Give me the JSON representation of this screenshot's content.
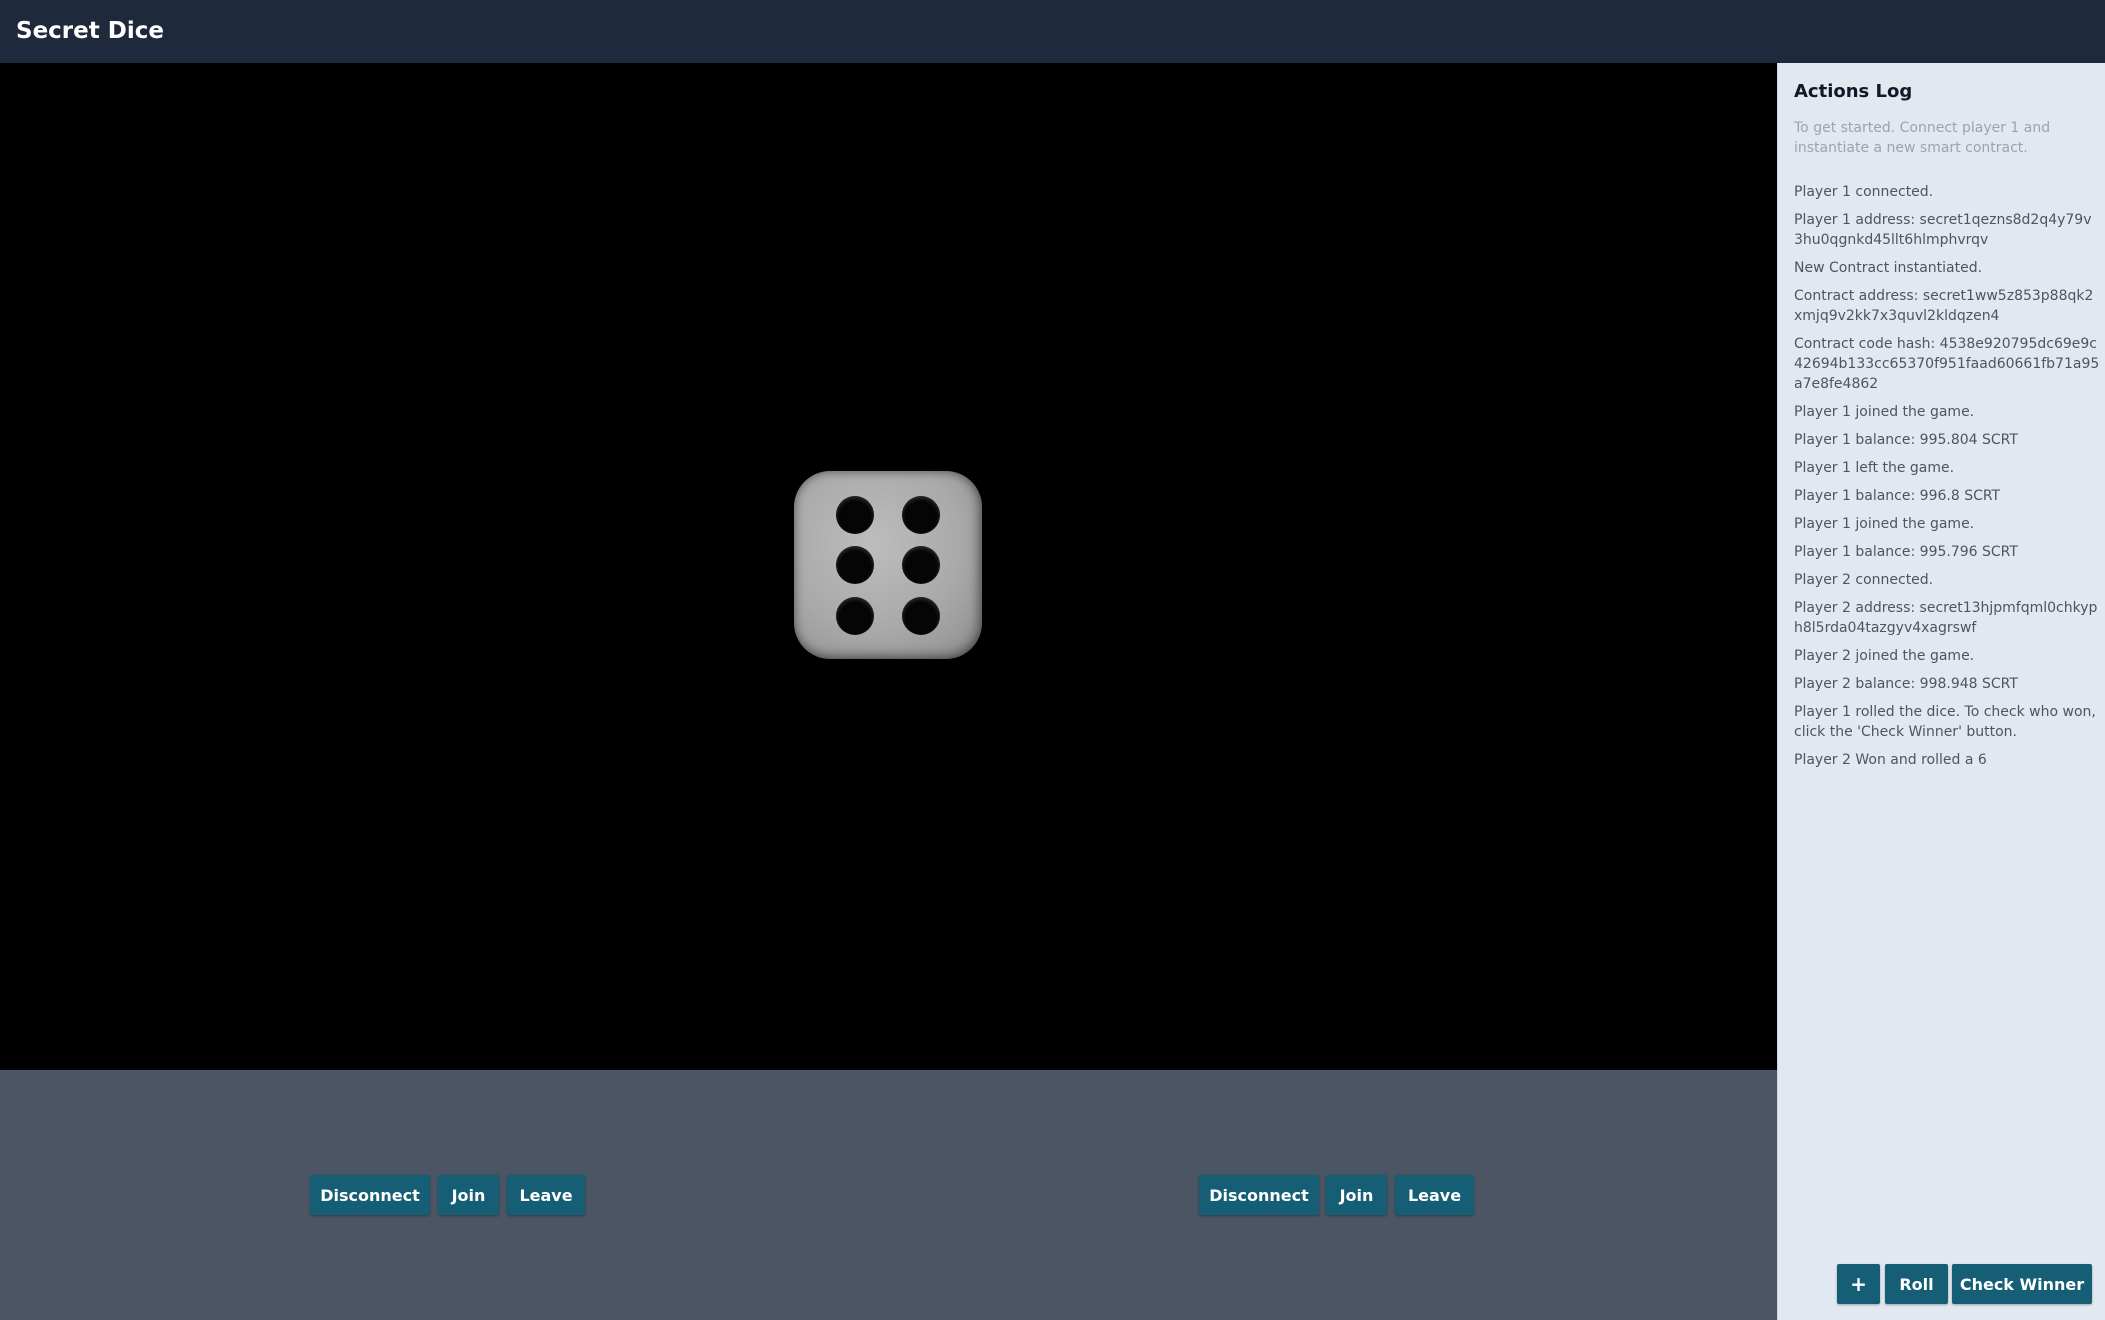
{
  "app": {
    "title": "Secret Dice"
  },
  "dice": {
    "face_value": 6,
    "pip_count": 6
  },
  "player1_controls": {
    "disconnect_label": "Disconnect",
    "join_label": "Join",
    "leave_label": "Leave"
  },
  "player2_controls": {
    "disconnect_label": "Disconnect",
    "join_label": "Join",
    "leave_label": "Leave"
  },
  "sidebar": {
    "title": "Actions Log",
    "hint": "To get started. Connect player 1 and instantiate a new smart contract.",
    "log": [
      "Player 1 connected.",
      "Player 1 address: secret1qezns8d2q4y79v3hu0qgnkd45llt6hlmphvrqv",
      "New Contract instantiated.",
      "Contract address: secret1ww5z853p88qk2xmjq9v2kk7x3quvl2kldqzen4",
      "Contract code hash: 4538e920795dc69e9c42694b133cc65370f951faad60661fb71a95a7e8fe4862",
      "Player 1 joined the game.",
      "Player 1 balance: 995.804 SCRT",
      "Player 1 left the game.",
      "Player 1 balance: 996.8 SCRT",
      "Player 1 joined the game.",
      "Player 1 balance: 995.796 SCRT",
      "Player 2 connected.",
      "Player 2 address: secret13hjpmfqml0chkyph8l5rda04tazgyv4xagrswf",
      "Player 2 joined the game.",
      "Player 2 balance: 998.948 SCRT",
      "Player 1 rolled the dice. To check who won, click the 'Check Winner' button.",
      "Player 2 Won and rolled a 6"
    ],
    "actions": {
      "add_label": "+",
      "roll_label": "Roll",
      "check_winner_label": "Check Winner"
    }
  },
  "colors": {
    "topbar": "#1e293b",
    "button": "#155e75",
    "controls_bg": "#4b5563",
    "sidebar_bg": "#e2e8f0"
  }
}
